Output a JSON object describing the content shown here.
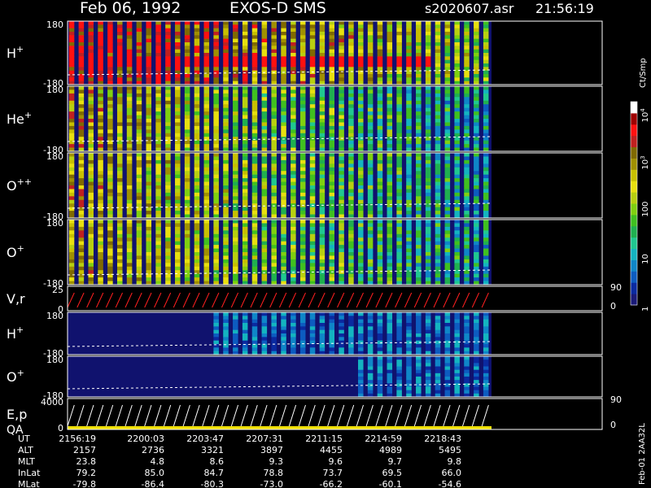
{
  "header": {
    "date": "Feb 06, 1992",
    "instrument": "EXOS-D SMS",
    "file": "s2020607.asr",
    "time": "21:56:19"
  },
  "panels": [
    {
      "id": "h",
      "label": "H",
      "sup": "+",
      "top_tick": "180",
      "bottom_tick": "-180"
    },
    {
      "id": "he",
      "label": "He",
      "sup": "+",
      "top_tick": "180",
      "bottom_tick": "-180"
    },
    {
      "id": "opp",
      "label": "O",
      "sup": "++",
      "top_tick": "180",
      "bottom_tick": "-180"
    },
    {
      "id": "op",
      "label": "O",
      "sup": "+",
      "top_tick": "180",
      "bottom_tick": "-180"
    },
    {
      "id": "vr",
      "label": "V,r",
      "sup": "",
      "top_tick": "25",
      "bottom_tick": "0",
      "right_top": "90",
      "right_bottom": "0"
    },
    {
      "id": "h2",
      "label": "H",
      "sup": "+",
      "top_tick": "180",
      "bottom_tick": "-180"
    },
    {
      "id": "o2",
      "label": "O",
      "sup": "+",
      "top_tick": "180",
      "bottom_tick": "-180"
    },
    {
      "id": "ep",
      "label": "E,p",
      "label2": "QA",
      "sup": "",
      "top_tick": "4000",
      "bottom_tick": "0",
      "right_top": "90",
      "right_bottom": "0"
    }
  ],
  "colorbar": {
    "unit": "Ct/Smp",
    "labels": [
      {
        "base": "10",
        "exp": "4",
        "value": 10000
      },
      {
        "base": "10",
        "exp": "3",
        "value": 1000
      },
      {
        "base": "100",
        "exp": "",
        "value": 100
      },
      {
        "base": "10",
        "exp": "",
        "value": 10
      },
      {
        "base": "1",
        "exp": "",
        "value": 1
      }
    ],
    "colors": [
      "#1a1a78",
      "#0a2aa0",
      "#0d5cc0",
      "#0f86c8",
      "#14b4c0",
      "#20c890",
      "#20b050",
      "#40c020",
      "#80d010",
      "#b8d010",
      "#e8e010",
      "#c8c000",
      "#a09000",
      "#806a00",
      "#c02020",
      "#ff1010",
      "#a00000",
      "#ffffff"
    ]
  },
  "footer": {
    "rows": [
      {
        "label": "UT",
        "values": [
          "2156:19",
          "2200:03",
          "2203:47",
          "2207:31",
          "2211:15",
          "2214:59",
          "2218:43"
        ]
      },
      {
        "label": "ALT",
        "values": [
          "2157",
          "2736",
          "3321",
          "3897",
          "4455",
          "4989",
          "5495"
        ]
      },
      {
        "label": "MLT",
        "values": [
          "23.8",
          "4.8",
          "8.6",
          "9.3",
          "9.6",
          "9.7",
          "9.8"
        ]
      },
      {
        "label": "InLat",
        "values": [
          "79.2",
          "85.0",
          "84.7",
          "78.8",
          "73.7",
          "69.5",
          "66.0"
        ]
      },
      {
        "label": "MLat",
        "values": [
          "-79.8",
          "-86.4",
          "-80.3",
          "-73.0",
          "-66.2",
          "-60.1",
          "-54.6"
        ]
      }
    ]
  },
  "side_label": "Feb-01 2AA32L"
}
